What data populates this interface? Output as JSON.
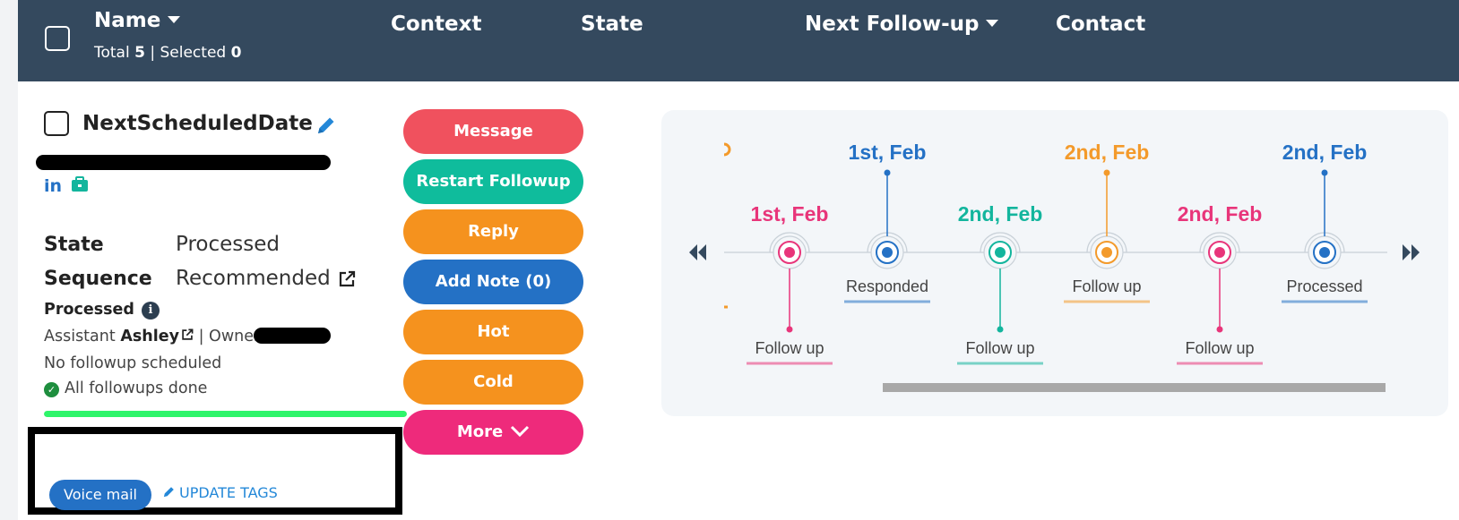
{
  "header": {
    "name_label": "Name",
    "context_label": "Context",
    "state_label": "State",
    "next_followup_label": "Next Follow-up",
    "contact_label": "Contact",
    "total_label": "Total",
    "total_count": "5",
    "separator": "|",
    "selected_label": "Selected",
    "selected_count": "0"
  },
  "record": {
    "title": "NextScheduledDate",
    "linkedin_label": "in",
    "state_key": "State",
    "state_value": "Processed",
    "sequence_key": "Sequence",
    "sequence_value": "Recommended",
    "status_text": "Processed",
    "assistant_label": "Assistant",
    "assistant_name": "Ashley",
    "owner_label": "| Owner",
    "followup_status": "No followup scheduled",
    "done_status": "All followups done",
    "progress": 1.0,
    "tag": "Voice mail",
    "update_tags_label": "UPDATE TAGS"
  },
  "actions": [
    {
      "label": "Message",
      "color": "#f0515e"
    },
    {
      "label": "Restart Followup",
      "color": "#0fbc9c"
    },
    {
      "label": "Reply",
      "color": "#f5921e"
    },
    {
      "label": "Add Note (0)",
      "color": "#2471c5"
    },
    {
      "label": "Hot",
      "color": "#f5921e"
    },
    {
      "label": "Cold",
      "color": "#f5921e"
    },
    {
      "label": "More",
      "color": "#ee2a7b"
    }
  ],
  "timeline": {
    "events": [
      {
        "date": "1st, Feb",
        "label": "Follow up",
        "color": "#e8357a",
        "side": "below"
      },
      {
        "date": "1st, Feb",
        "label": "Responded",
        "color": "#2471c5",
        "side": "above"
      },
      {
        "date": "2nd, Feb",
        "label": "Follow up",
        "color": "#13b59d",
        "side": "below"
      },
      {
        "date": "2nd, Feb",
        "label": "Follow up",
        "color": "#f39a2b",
        "side": "above"
      },
      {
        "date": "2nd, Feb",
        "label": "Follow up",
        "color": "#e8357a",
        "side": "below"
      },
      {
        "date": "2nd, Feb",
        "label": "Processed",
        "color": "#2471c5",
        "side": "above"
      }
    ],
    "partial_left_color": "#f39a2b"
  }
}
